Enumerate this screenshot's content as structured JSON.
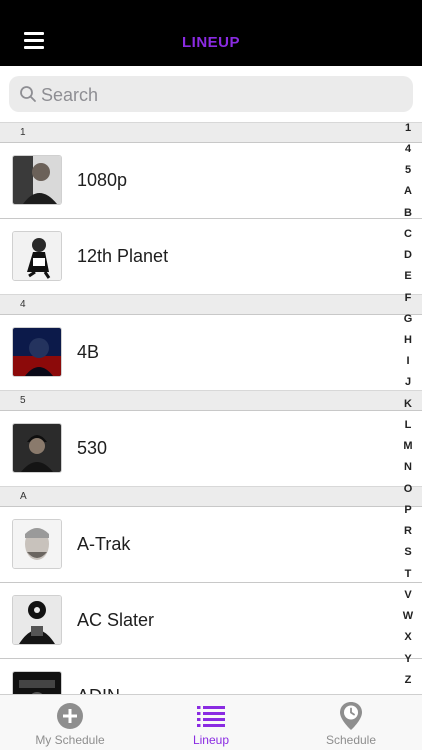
{
  "header": {
    "title": "LINEUP",
    "title_color": "#8a2be2"
  },
  "search": {
    "placeholder": "Search"
  },
  "sections": [
    {
      "letter": "1",
      "rows": [
        "1080p",
        "12th Planet"
      ]
    },
    {
      "letter": "4",
      "rows": [
        "4B"
      ]
    },
    {
      "letter": "5",
      "rows": [
        "530"
      ]
    },
    {
      "letter": "A",
      "rows": [
        "A-Trak",
        "AC Slater",
        "ADIN"
      ]
    }
  ],
  "index": [
    "1",
    "4",
    "5",
    "A",
    "B",
    "C",
    "D",
    "E",
    "F",
    "G",
    "H",
    "I",
    "J",
    "K",
    "L",
    "M",
    "N",
    "O",
    "P",
    "R",
    "S",
    "T",
    "V",
    "W",
    "X",
    "Y",
    "Z"
  ],
  "tabs": [
    {
      "label": "My Schedule",
      "icon": "add-circle-icon",
      "active": false
    },
    {
      "label": "Lineup",
      "icon": "list-icon",
      "active": true
    },
    {
      "label": "Schedule",
      "icon": "location-clock-icon",
      "active": false
    }
  ],
  "colors": {
    "accent": "#8a2be2",
    "inactive_tab": "#8e8e8e",
    "header_bg": "#000000"
  }
}
